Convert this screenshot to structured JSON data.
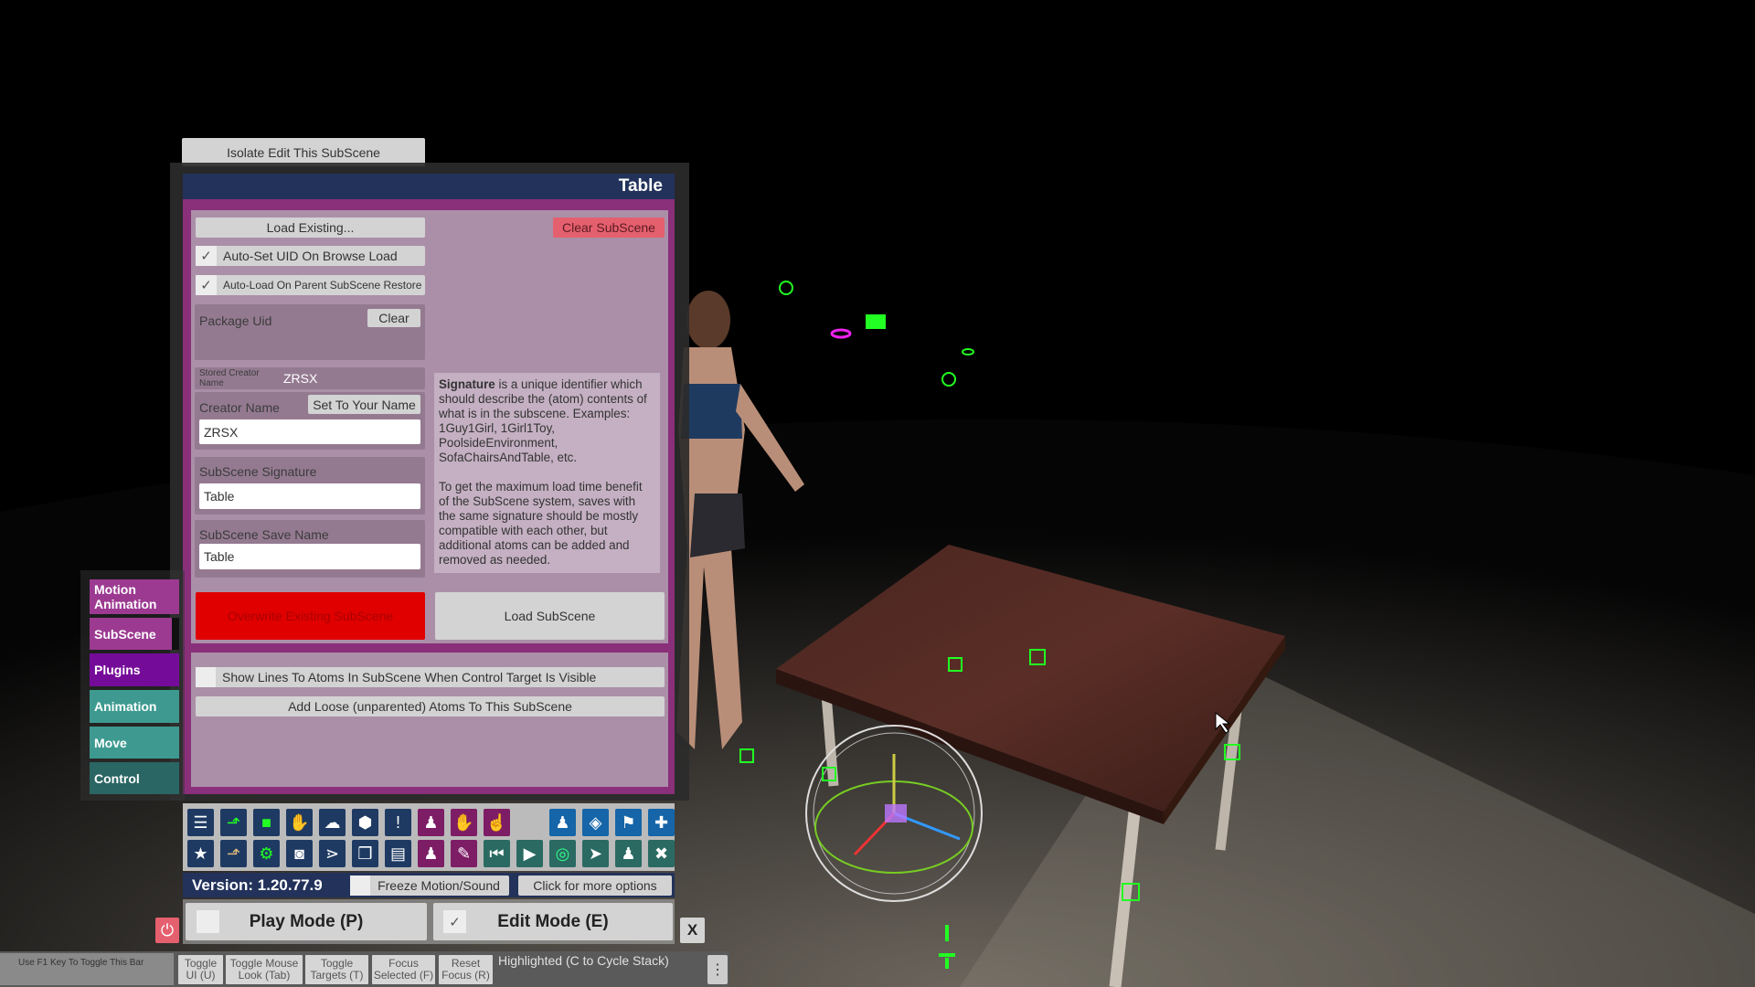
{
  "colors": {
    "header": "#22325a",
    "panel_purple": "#8a2f7a",
    "panel_lavender": "#ab8fa8",
    "overwrite_red": "#e00000",
    "clear_red": "#e5606e",
    "accent_green": "#22ff22"
  },
  "isolate_button": "Isolate Edit This SubScene",
  "panel": {
    "title": "Table",
    "load_existing": "Load Existing...",
    "clear_subscene": "Clear SubScene",
    "auto_set_uid": {
      "label": "Auto-Set UID On Browse Load",
      "checked": true
    },
    "auto_load_parent": {
      "label": "Auto-Load On Parent SubScene Restore",
      "checked": true
    },
    "package_uid": {
      "label": "Package Uid",
      "clear": "Clear"
    },
    "stored_creator": {
      "label": "Stored Creator Name",
      "value": "ZRSX"
    },
    "creator_name": {
      "label": "Creator Name",
      "set_button": "Set To Your Name",
      "value": "ZRSX"
    },
    "signature": {
      "label": "SubScene Signature",
      "value": "Table"
    },
    "save_name": {
      "label": "SubScene Save Name",
      "value": "Table"
    },
    "info": {
      "bold": "Signature",
      "p1": " is a unique identifier which should describe the (atom) contents of what is in the subscene. Examples: 1Guy1Girl, 1Girl1Toy, PoolsideEnvironment, SofaChairsAndTable, etc.",
      "p2": "To get the maximum load time benefit of the SubScene system, saves with the same signature should be mostly compatible with each other, but additional atoms can be added and removed as needed."
    },
    "overwrite": "Overwrite Existing SubScene",
    "load_subscene": "Load SubScene",
    "show_lines": {
      "label": "Show Lines To Atoms In SubScene When Control Target Is Visible",
      "checked": false
    },
    "add_loose": "Add Loose (unparented) Atoms To This SubScene"
  },
  "tabs": [
    {
      "label": "Motion Animation",
      "color": "#9c3a91"
    },
    {
      "label": "SubScene",
      "color": "#9c3a91"
    },
    {
      "label": "Plugins",
      "color": "#750c99"
    },
    {
      "label": "Animation",
      "color": "#3e9a90"
    },
    {
      "label": "Move",
      "color": "#3e9a90"
    },
    {
      "label": "Control",
      "color": "#2a6663"
    }
  ],
  "toolbar": {
    "row1": [
      {
        "icon": "menu-icon",
        "glyph": "☰",
        "bg": "#1e3a63",
        "fg": "#fff"
      },
      {
        "icon": "open-scene-icon",
        "glyph": "⬏",
        "bg": "#1e3a63",
        "fg": "#2f2"
      },
      {
        "icon": "folder-icon",
        "glyph": "■",
        "bg": "#1e3a63",
        "fg": "#2f2"
      },
      {
        "icon": "hand-red-icon",
        "glyph": "✋",
        "bg": "#1e3a63",
        "fg": "#e22"
      },
      {
        "icon": "cloud-download-icon",
        "glyph": "☁",
        "bg": "#1e3a63",
        "fg": "#fff"
      },
      {
        "icon": "cube-icon",
        "glyph": "⬢",
        "bg": "#1e3a63",
        "fg": "#fff"
      },
      {
        "icon": "alert-icon",
        "glyph": "!",
        "bg": "#1e3a63",
        "fg": "#fff"
      },
      {
        "icon": "person-add-icon",
        "glyph": "♟",
        "bg": "#7d1d66",
        "fg": "#fff"
      },
      {
        "icon": "hand-icon",
        "glyph": "✋",
        "bg": "#7d1d66",
        "fg": "#fff"
      },
      {
        "icon": "pointer-hand-icon",
        "glyph": "☝",
        "bg": "#7d1d66",
        "fg": "#fff"
      },
      {
        "icon": "person-icon",
        "glyph": "♟",
        "bg": "#1565a8",
        "fg": "#fff"
      },
      {
        "icon": "unity-icon",
        "glyph": "◈",
        "bg": "#1565a8",
        "fg": "#fff"
      },
      {
        "icon": "flag-icon",
        "glyph": "⚑",
        "bg": "#1565a8",
        "fg": "#fff"
      },
      {
        "icon": "plus-icon",
        "glyph": "✚",
        "bg": "#1565a8",
        "fg": "#fff"
      }
    ],
    "row2": [
      {
        "icon": "star-icon",
        "glyph": "★",
        "bg": "#1e3a63",
        "fg": "#fff"
      },
      {
        "icon": "folder-open-icon",
        "glyph": "⬏",
        "bg": "#1e3a63",
        "fg": "#d9b77a"
      },
      {
        "icon": "folder-gear-icon",
        "glyph": "⚙",
        "bg": "#1e3a63",
        "fg": "#2f2"
      },
      {
        "icon": "camera-icon",
        "glyph": "◙",
        "bg": "#1e3a63",
        "fg": "#fff"
      },
      {
        "icon": "node-graph-icon",
        "glyph": "⋗",
        "bg": "#1e3a63",
        "fg": "#fff"
      },
      {
        "icon": "box-open-icon",
        "glyph": "❒",
        "bg": "#1e3a63",
        "fg": "#fff"
      },
      {
        "icon": "document-icon",
        "glyph": "▤",
        "bg": "#1e3a63",
        "fg": "#fff"
      },
      {
        "icon": "person-remove-icon",
        "glyph": "♟",
        "bg": "#7d1d66",
        "fg": "#fff"
      },
      {
        "icon": "grab-icon",
        "glyph": "✎",
        "bg": "#7d1d66",
        "fg": "#fff"
      },
      {
        "icon": "skip-back-icon",
        "glyph": "⏮",
        "bg": "#2a6a62",
        "fg": "#fff"
      },
      {
        "icon": "play-icon",
        "glyph": "▶",
        "bg": "#2a6a62",
        "fg": "#fff"
      },
      {
        "icon": "crosshair-icon",
        "glyph": "◎",
        "bg": "#2a6a62",
        "fg": "#3f8"
      },
      {
        "icon": "cursor-icon",
        "glyph": "➤",
        "bg": "#2a6a62",
        "fg": "#fff"
      },
      {
        "icon": "people-icon",
        "glyph": "♟",
        "bg": "#2a6a62",
        "fg": "#fff"
      },
      {
        "icon": "tools-icon",
        "glyph": "✖",
        "bg": "#2a6a62",
        "fg": "#fff"
      }
    ]
  },
  "version": "Version: 1.20.77.9",
  "freeze": {
    "label": "Freeze Motion/Sound",
    "checked": false
  },
  "more_options": "Click for more options",
  "play_mode": {
    "label": "Play Mode (P)",
    "checked": false
  },
  "edit_mode": {
    "label": "Edit Mode (E)",
    "checked": true
  },
  "close": "X",
  "bottom_bar": {
    "hint": "Use F1 Key To Toggle This Bar",
    "buttons": [
      "Toggle UI (U)",
      "Toggle Mouse Look (Tab)",
      "Toggle Targets (T)",
      "Focus Selected (F)",
      "Reset Focus (R)"
    ],
    "status": "Highlighted (C to Cycle Stack)"
  }
}
